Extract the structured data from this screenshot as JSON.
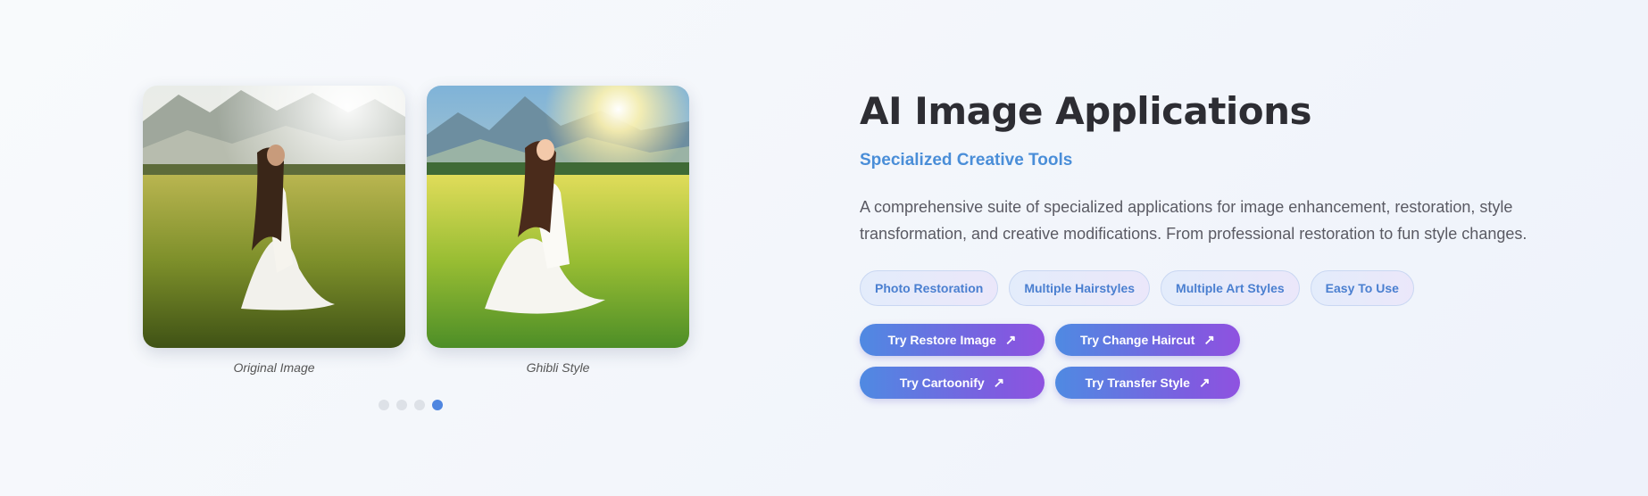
{
  "gallery": {
    "images": [
      {
        "caption": "Original Image"
      },
      {
        "caption": "Ghibli Style"
      }
    ],
    "dots_total": 4,
    "active_dot": 4
  },
  "content": {
    "title": "AI Image Applications",
    "subtitle": "Specialized Creative Tools",
    "description": "A comprehensive suite of specialized applications for image enhancement, restoration, style transformation, and creative modifications. From professional restoration to fun style changes.",
    "tags": [
      "Photo Restoration",
      "Multiple Hairstyles",
      "Multiple Art Styles",
      "Easy To Use"
    ],
    "buttons": [
      {
        "label": "Try Restore Image",
        "icon": "arrow-up-right-icon"
      },
      {
        "label": "Try Change Haircut",
        "icon": "arrow-up-right-icon"
      },
      {
        "label": "Try Cartoonify",
        "icon": "arrow-up-right-icon"
      },
      {
        "label": "Try Transfer Style",
        "icon": "arrow-up-right-icon"
      }
    ]
  },
  "colors": {
    "accent_blue": "#4a8ed8",
    "button_gradient_start": "#4f8ae2",
    "button_gradient_end": "#8f52e0",
    "active_dot": "#4f86e0"
  }
}
